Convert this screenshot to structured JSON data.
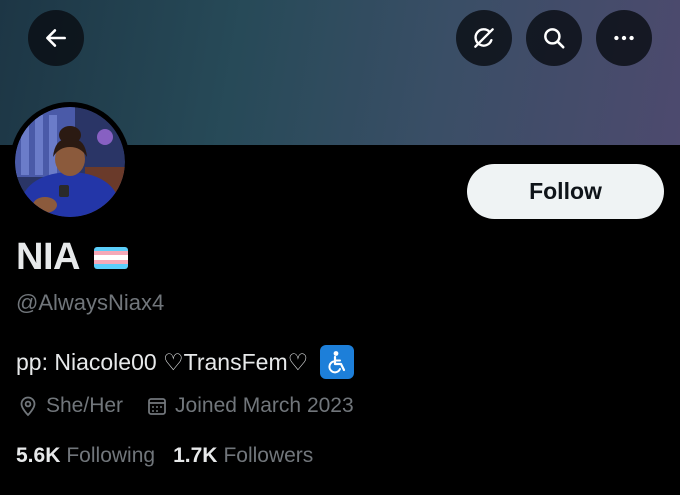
{
  "header": {
    "back_icon": "arrow-left-icon",
    "grok_icon": "grok-icon",
    "search_icon": "search-icon",
    "more_icon": "more-horizontal-icon"
  },
  "profile": {
    "display_name": "NIA",
    "flag_colors": [
      "#5bcefa",
      "#f5a9b8",
      "#ffffff",
      "#f5a9b8",
      "#5bcefa"
    ],
    "handle": "@AlwaysNiax4",
    "bio_text": "pp: Niacole00 ♡TransFem♡",
    "bio_emoji": "wheelchair-symbol-icon",
    "pronouns": "She/Her",
    "joined": "Joined March 2023"
  },
  "actions": {
    "follow_label": "Follow"
  },
  "stats": {
    "following_count": "5.6K",
    "following_label": "Following",
    "followers_count": "1.7K",
    "followers_label": "Followers"
  },
  "colors": {
    "background": "#000000",
    "text_primary": "#e7e9ea",
    "text_secondary": "#71767b",
    "follow_button_bg": "#eff3f4",
    "accessibility_blue": "#1d7fd9"
  }
}
